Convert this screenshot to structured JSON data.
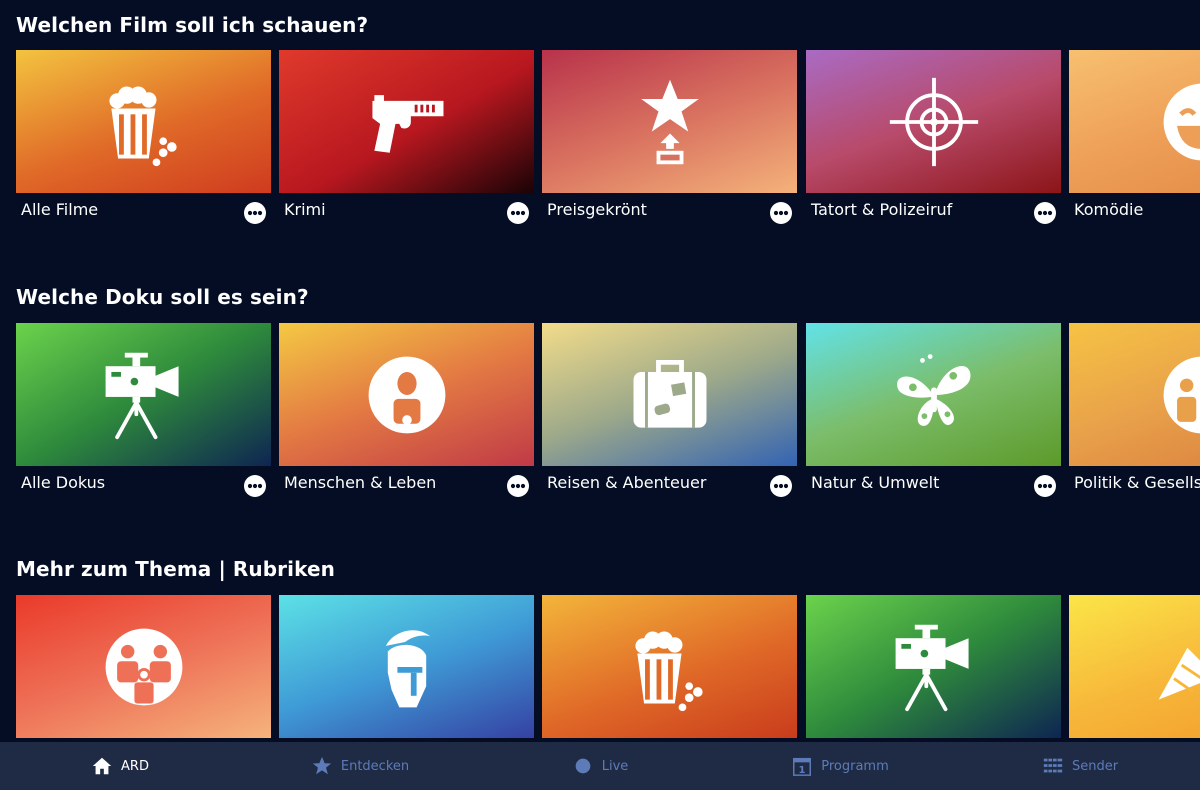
{
  "sections": [
    {
      "title": "Welchen Film soll ich schauen?",
      "cards": [
        {
          "label": "Alle Filme",
          "icon": "popcorn-icon",
          "colors": [
            "#f3c33f",
            "#e06a28",
            "#cf3b1f"
          ]
        },
        {
          "label": "Krimi",
          "icon": "pistol-icon",
          "colors": [
            "#e03a2c",
            "#b7171f",
            "#1a0306"
          ]
        },
        {
          "label": "Preisgekrönt",
          "icon": "trophy-star-icon",
          "colors": [
            "#b8324b",
            "#d8705f",
            "#f4b27a"
          ]
        },
        {
          "label": "Tatort & Polizeiruf",
          "icon": "crosshair-icon",
          "colors": [
            "#a96bc4",
            "#b84a6a",
            "#8c1518"
          ]
        },
        {
          "label": "Komödie",
          "icon": "laughing-face-icon",
          "colors": [
            "#f7c070",
            "#ee9f57",
            "#e08845"
          ]
        }
      ]
    },
    {
      "title": "Welche Doku soll es sein?",
      "cards": [
        {
          "label": "Alle Dokus",
          "icon": "video-camera-icon",
          "colors": [
            "#6bd34c",
            "#2e8a3c",
            "#0e2552"
          ]
        },
        {
          "label": "Menschen & Leben",
          "icon": "person-icon",
          "colors": [
            "#f4c943",
            "#e37943",
            "#c03a47"
          ]
        },
        {
          "label": "Reisen & Abenteuer",
          "icon": "suitcase-icon",
          "colors": [
            "#f2dc8a",
            "#9da98a",
            "#3363b3"
          ]
        },
        {
          "label": "Natur & Umwelt",
          "icon": "butterfly-icon",
          "colors": [
            "#62e2e8",
            "#7bbd6a",
            "#5c9a2a"
          ]
        },
        {
          "label": "Politik & Gesellsc",
          "icon": "people-icon",
          "colors": [
            "#f6c344",
            "#e8a04a",
            "#d87c3c"
          ]
        }
      ]
    },
    {
      "title": "Mehr zum Thema | Rubriken",
      "cards": [
        {
          "label": "",
          "icon": "family-icon",
          "colors": [
            "#ea3a2a",
            "#ee7157",
            "#f5b37c"
          ]
        },
        {
          "label": "",
          "icon": "gladiator-helmet-icon",
          "colors": [
            "#5ce1e6",
            "#3f9bd6",
            "#3541a3"
          ]
        },
        {
          "label": "",
          "icon": "popcorn-icon",
          "colors": [
            "#f3b53a",
            "#e06a28",
            "#c93c1c"
          ]
        },
        {
          "label": "",
          "icon": "video-camera-icon",
          "colors": [
            "#6bd34c",
            "#2e8a3c",
            "#0e2552"
          ]
        },
        {
          "label": "",
          "icon": "party-popper-icon",
          "colors": [
            "#fbe548",
            "#f7b83a",
            "#f29a2c"
          ]
        }
      ]
    }
  ],
  "tabbar": {
    "tabs": [
      {
        "label": "ARD",
        "icon": "home-icon",
        "active": true
      },
      {
        "label": "Entdecken",
        "icon": "star-icon",
        "active": false
      },
      {
        "label": "Live",
        "icon": "live-dot-icon",
        "active": false
      },
      {
        "label": "Programm",
        "icon": "calendar-icon",
        "active": false,
        "badge": "1"
      },
      {
        "label": "Sender",
        "icon": "grid-icon",
        "active": false
      }
    ],
    "active_color": "#ffffff",
    "inactive_color": "#5c7bb8"
  }
}
